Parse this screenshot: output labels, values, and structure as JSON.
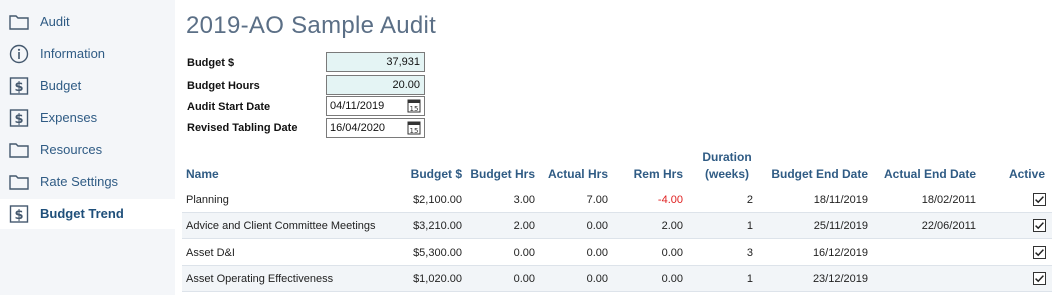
{
  "sidebar": {
    "items": [
      {
        "label": "Audit",
        "icon": "folder-icon",
        "active": false
      },
      {
        "label": "Information",
        "icon": "info-icon",
        "active": false
      },
      {
        "label": "Budget",
        "icon": "dollar-icon",
        "active": false
      },
      {
        "label": "Expenses",
        "icon": "dollar-icon",
        "active": false
      },
      {
        "label": "Resources",
        "icon": "folder-icon",
        "active": false
      },
      {
        "label": "Rate Settings",
        "icon": "folder-icon",
        "active": false
      },
      {
        "label": "Budget Trend",
        "icon": "dollar-icon",
        "active": true
      }
    ]
  },
  "title": "2019-AO Sample Audit",
  "form": {
    "budget_label": "Budget $",
    "budget_value": "37,931",
    "hours_label": "Budget Hours",
    "hours_value": "20.00",
    "start_label": "Audit Start Date",
    "start_value": "04/11/2019",
    "tabling_label": "Revised Tabling Date",
    "tabling_value": "16/04/2020"
  },
  "table": {
    "headers": {
      "name": "Name",
      "budget": "Budget $",
      "budget_hrs": "Budget Hrs",
      "actual_hrs": "Actual Hrs",
      "rem_hrs": "Rem Hrs",
      "duration_line1": "Duration",
      "duration_line2": "(weeks)",
      "budget_end": "Budget End Date",
      "actual_end": "Actual End Date",
      "active": "Active"
    },
    "rows": [
      {
        "name": "Planning",
        "budget": "$2,100.00",
        "budget_hrs": "3.00",
        "actual_hrs": "7.00",
        "rem_hrs": "-4.00",
        "duration": "2",
        "budget_end": "18/11/2019",
        "actual_end": "18/02/2011",
        "active": true
      },
      {
        "name": "Advice and Client Committee Meetings",
        "budget": "$3,210.00",
        "budget_hrs": "2.00",
        "actual_hrs": "0.00",
        "rem_hrs": "2.00",
        "duration": "1",
        "budget_end": "25/11/2019",
        "actual_end": "22/06/2011",
        "active": true
      },
      {
        "name": "Asset D&I",
        "budget": "$5,300.00",
        "budget_hrs": "0.00",
        "actual_hrs": "0.00",
        "rem_hrs": "0.00",
        "duration": "3",
        "budget_end": "16/12/2019",
        "actual_end": "",
        "active": true
      },
      {
        "name": "Asset Operating Effectiveness",
        "budget": "$1,020.00",
        "budget_hrs": "0.00",
        "actual_hrs": "0.00",
        "rem_hrs": "0.00",
        "duration": "1",
        "budget_end": "23/12/2019",
        "actual_end": "",
        "active": true
      }
    ]
  },
  "colors": {
    "accent": "#2f5b84",
    "title": "#5b6f86",
    "negative": "#e02020",
    "number_field_bg": "#e4f4f4"
  }
}
